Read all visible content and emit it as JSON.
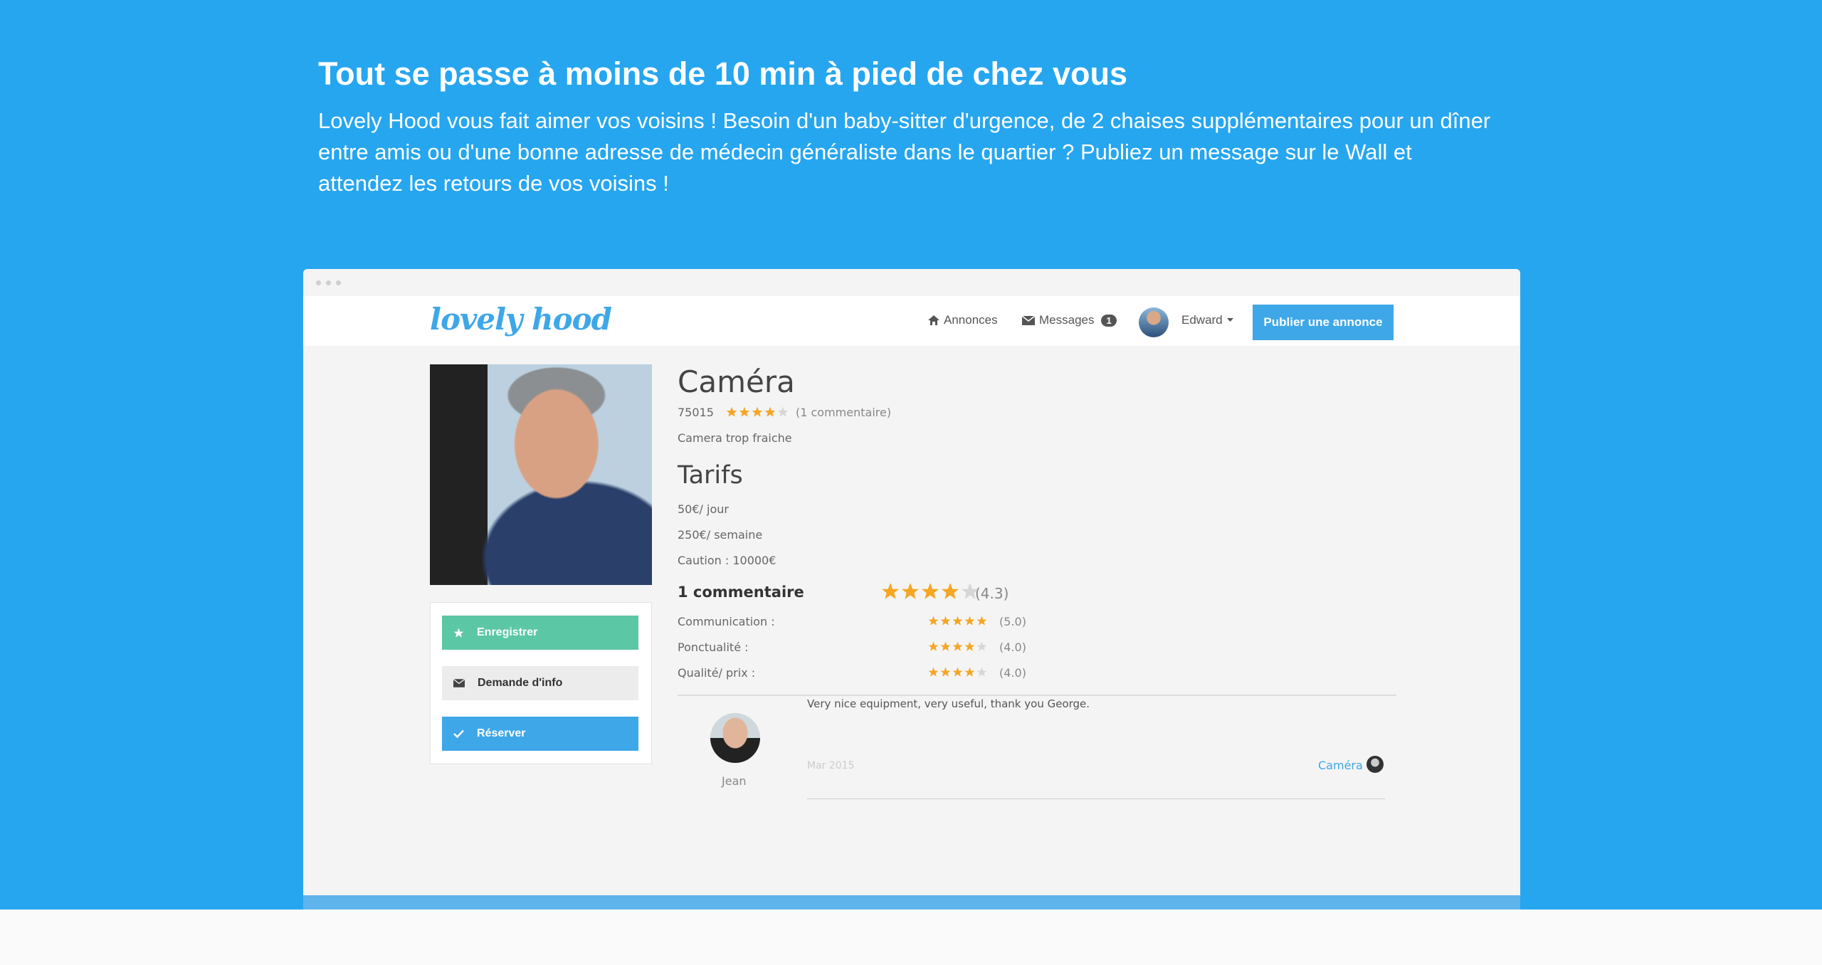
{
  "hero": {
    "title": "Tout se passe à moins de 10 min à pied de chez vous",
    "text": "Lovely Hood vous fait aimer vos voisins ! Besoin d'un baby-sitter d'urgence, de 2 chaises supplémentaires pour un dîner entre amis ou d'une bonne adresse de médecin généraliste dans le quartier ? Publiez un message sur le Wall et attendez les retours de vos voisins !"
  },
  "navbar": {
    "logo": "lovely hood",
    "annonces": "Annonces",
    "messages": "Messages",
    "messages_count": "1",
    "user": "Edward",
    "publish": "Publier une annonce"
  },
  "sidebar": {
    "save": "Enregistrer",
    "info": "Demande d'info",
    "book": "Réserver"
  },
  "listing": {
    "title": "Caméra",
    "postcode": "75015",
    "rating_stars": 4,
    "comments_count": "(1 commentaire)",
    "description": "Camera trop fraiche",
    "prices_title": "Tarifs",
    "price_day": "50€/ jour",
    "price_week": "250€/ semaine",
    "deposit": "Caution : 10000€"
  },
  "reviews": {
    "header": "1 commentaire",
    "overall_stars": 4,
    "overall": "(4.3)",
    "criteria": [
      {
        "label": "Communication :",
        "stars": 5,
        "value": "(5.0)"
      },
      {
        "label": "Ponctualité :",
        "stars": 4,
        "value": "(4.0)"
      },
      {
        "label": "Qualité/ prix :",
        "stars": 4,
        "value": "(4.0)"
      }
    ],
    "item": {
      "author": "Jean",
      "text": "Very nice equipment, very useful, thank you George.",
      "date": "Mar 2015",
      "link": "Caméra"
    }
  },
  "colors": {
    "hero_bg": "#26a6ef",
    "accent": "#3ea7e8",
    "save_btn": "#5cc7a5",
    "star": "#f5a623"
  }
}
